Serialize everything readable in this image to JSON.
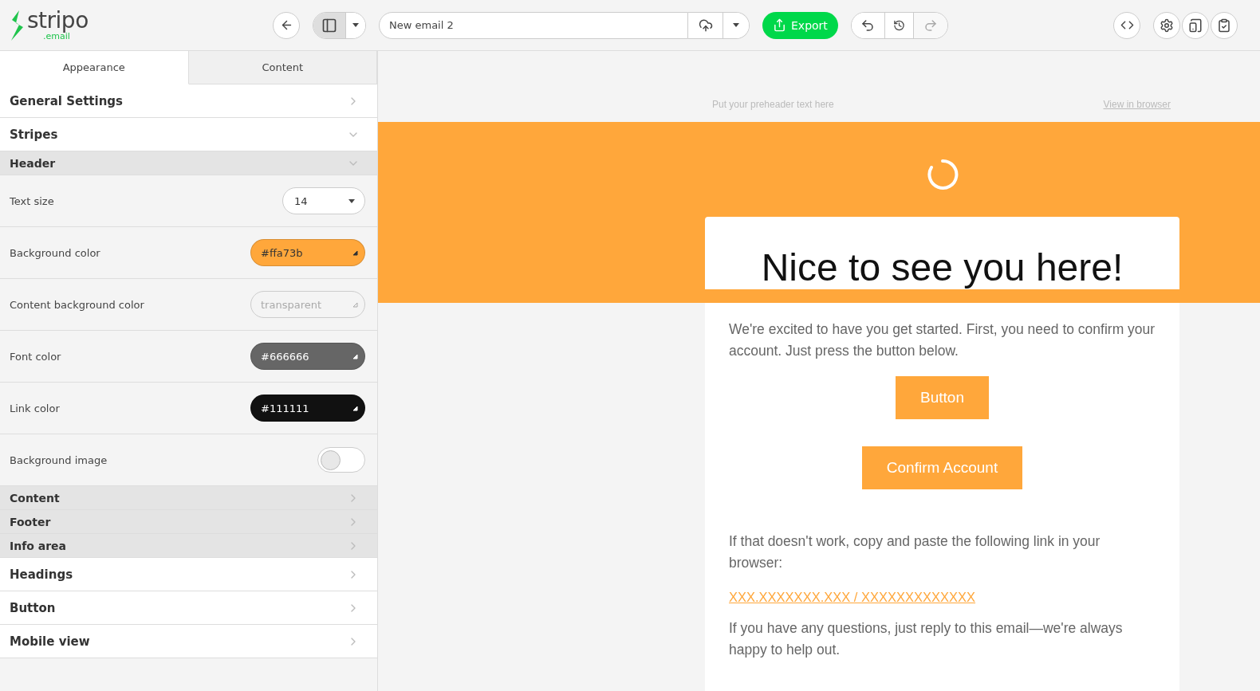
{
  "toolbar": {
    "logo": {
      "name": "stripo",
      "suffix": ".email"
    },
    "view_toggle": {
      "selected": true
    },
    "email_name": {
      "value": "New email 2"
    },
    "export": {
      "label": "Export"
    },
    "redo": {
      "disabled": true
    }
  },
  "panel": {
    "tabs": [
      {
        "label": "Appearance",
        "selected": true
      },
      {
        "label": "Content",
        "selected": false
      }
    ],
    "sections": [
      {
        "title": "General Settings",
        "expanded": false
      },
      {
        "title": "Stripes",
        "expanded": true,
        "children": [
          {
            "title": "Header",
            "expanded": true,
            "settings": [
              {
                "kind": "select",
                "label": "Text size",
                "value": "14"
              },
              {
                "kind": "color",
                "label": "Background color",
                "value": "#ffa73b",
                "color": "#ffa73b"
              },
              {
                "kind": "color",
                "label": "Content background color",
                "placeholder": "transparent"
              },
              {
                "kind": "color",
                "label": "Font color",
                "value": "#666666",
                "color": "#666666"
              },
              {
                "kind": "color",
                "label": "Link color",
                "value": "#111111",
                "color": "#111111"
              },
              {
                "kind": "toggle",
                "label": "Background image",
                "on": false
              }
            ]
          },
          {
            "title": "Content",
            "expanded": false
          },
          {
            "title": "Footer",
            "expanded": false
          },
          {
            "title": "Info area",
            "expanded": false
          }
        ]
      },
      {
        "title": "Headings",
        "expanded": false
      },
      {
        "title": "Button",
        "expanded": false
      },
      {
        "title": "Mobile view",
        "expanded": false
      }
    ]
  },
  "email": {
    "preheader": "Put your preheader text here",
    "view_in_browser": "View in browser",
    "title": "Nice to see you here!",
    "blocks": [
      {
        "kind": "text",
        "text": "We're excited to have you get started. First, you need to confirm your account. Just press the button below."
      },
      {
        "kind": "button",
        "label": "Button"
      },
      {
        "kind": "button",
        "label": "Confirm Account"
      },
      {
        "kind": "text",
        "text": "If that doesn't work, copy and paste the following link in your browser:"
      },
      {
        "kind": "link",
        "text": "XXX.XXXXXXX.XXX / XXXXXXXXXXXXX"
      },
      {
        "kind": "text",
        "text": "If you have any questions, just reply to this email—we're always happy to help out."
      }
    ]
  }
}
